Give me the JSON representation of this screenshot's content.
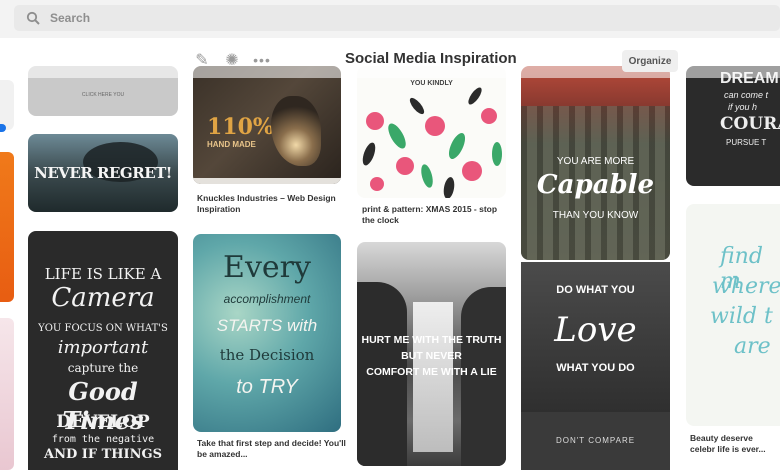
{
  "search": {
    "placeholder": "Search"
  },
  "toolbar": {
    "title": "Social Media Inspiration",
    "organize_label": "Organize"
  },
  "icons": {
    "search": "search-icon",
    "edit": "pencil-icon",
    "settings": "gear-icon",
    "more": "more-icon"
  },
  "pins": {
    "click_here": "CLICK HERE YOU",
    "never_regret": "NEVER REGRET!",
    "knuckles": {
      "line1": "110%",
      "line2": "HAND MADE",
      "caption": "Knuckles Industries – Web Design Inspiration"
    },
    "xmas": {
      "text": "YOU KINDLY",
      "caption": "print & pattern: XMAS 2015 - stop the clock"
    },
    "capable": {
      "line1": "YOU ARE MORE",
      "line2": "Capable",
      "line3": "THAN YOU KNOW"
    },
    "dream": {
      "line1": "DREAM",
      "line2": "can come t",
      "line3": "if you h",
      "line4": "COURAG",
      "line5": "PURSUE T"
    },
    "camera": {
      "lines": [
        "LIFE IS LIKE A",
        "Camera",
        "YOU FOCUS ON WHAT'S",
        "important",
        "capture the",
        "Good Times",
        "DEVELOP",
        "from the negative",
        "AND IF THINGS"
      ]
    },
    "every": {
      "lines": [
        "Every",
        "accomplishment",
        "STARTS with",
        "the Decision",
        "to TRY"
      ],
      "caption": "Take that first step and decide! You'll be amazed..."
    },
    "waterfall": {
      "lines": [
        "HURT ME WITH THE TRUTH",
        "BUT NEVER",
        "COMFORT ME WITH A LIE"
      ]
    },
    "love": {
      "line1": "DO WHAT YOU",
      "line2": "Love",
      "line3": "WHAT YOU DO"
    },
    "dont_compare": "DON'T COMPARE",
    "find_me": {
      "lines": [
        "find m",
        "where",
        "wild t",
        "are"
      ],
      "caption": "Beauty deserve celebr life is ever..."
    }
  },
  "colors": {
    "accent": "#e60023",
    "link": "#1a73e8"
  }
}
